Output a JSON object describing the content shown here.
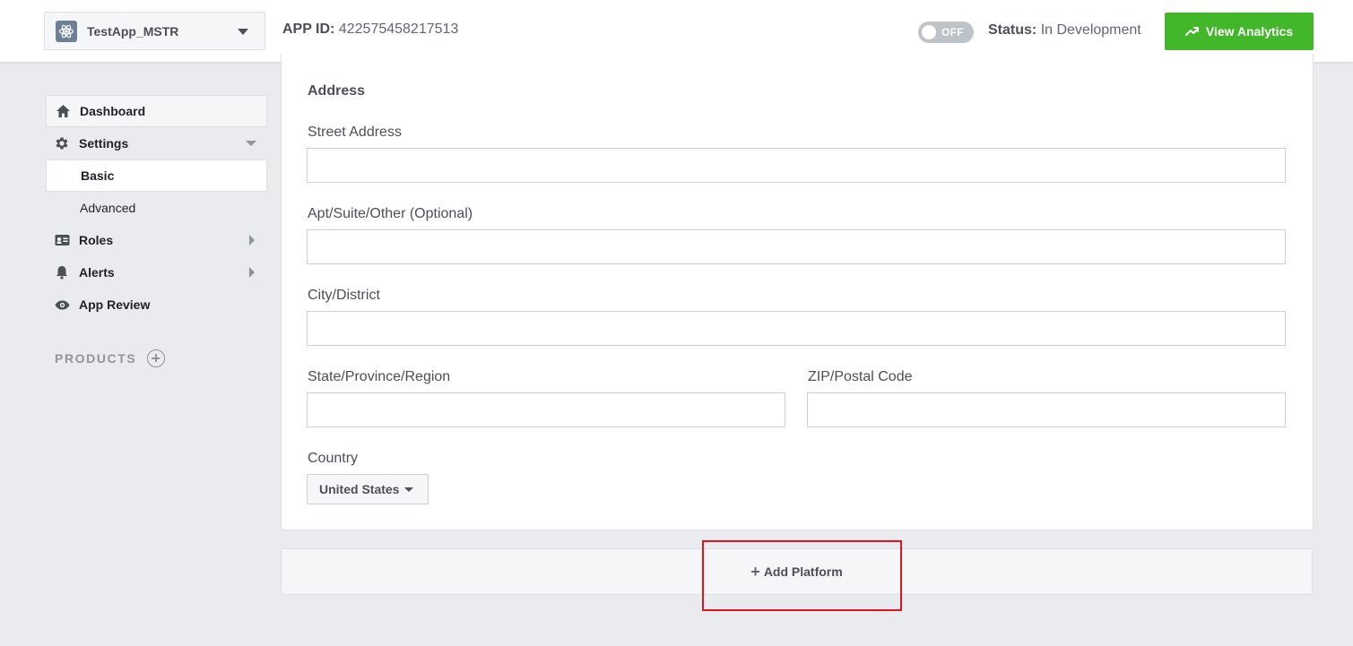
{
  "header": {
    "app_name": "TestApp_MSTR",
    "app_id_label": "APP ID:",
    "app_id_value": "422575458217513",
    "toggle_text": "OFF",
    "status_label": "Status:",
    "status_value": "In Development",
    "analytics_button": "View Analytics"
  },
  "sidebar": {
    "dashboard": "Dashboard",
    "settings": "Settings",
    "basic": "Basic",
    "advanced": "Advanced",
    "roles": "Roles",
    "alerts": "Alerts",
    "app_review": "App Review",
    "products": "PRODUCTS"
  },
  "form": {
    "section_title": "Address",
    "street_label": "Street Address",
    "street_value": "",
    "apt_label": "Apt/Suite/Other (Optional)",
    "apt_value": "",
    "city_label": "City/District",
    "city_value": "",
    "state_label": "State/Province/Region",
    "state_value": "",
    "zip_label": "ZIP/Postal Code",
    "zip_value": "",
    "country_label": "Country",
    "country_value": "United States"
  },
  "add_platform": "Add Platform",
  "colors": {
    "accent_green": "#42b72a",
    "highlight_red": "#e0141e",
    "background": "#e9ebee"
  },
  "icons": {
    "app": "atom-icon",
    "analytics": "trending-up-icon",
    "dashboard": "home-icon",
    "settings": "gear-icon",
    "roles": "id-card-icon",
    "alerts": "bell-icon",
    "app_review": "eye-icon",
    "add_product": "plus-circle-icon"
  }
}
